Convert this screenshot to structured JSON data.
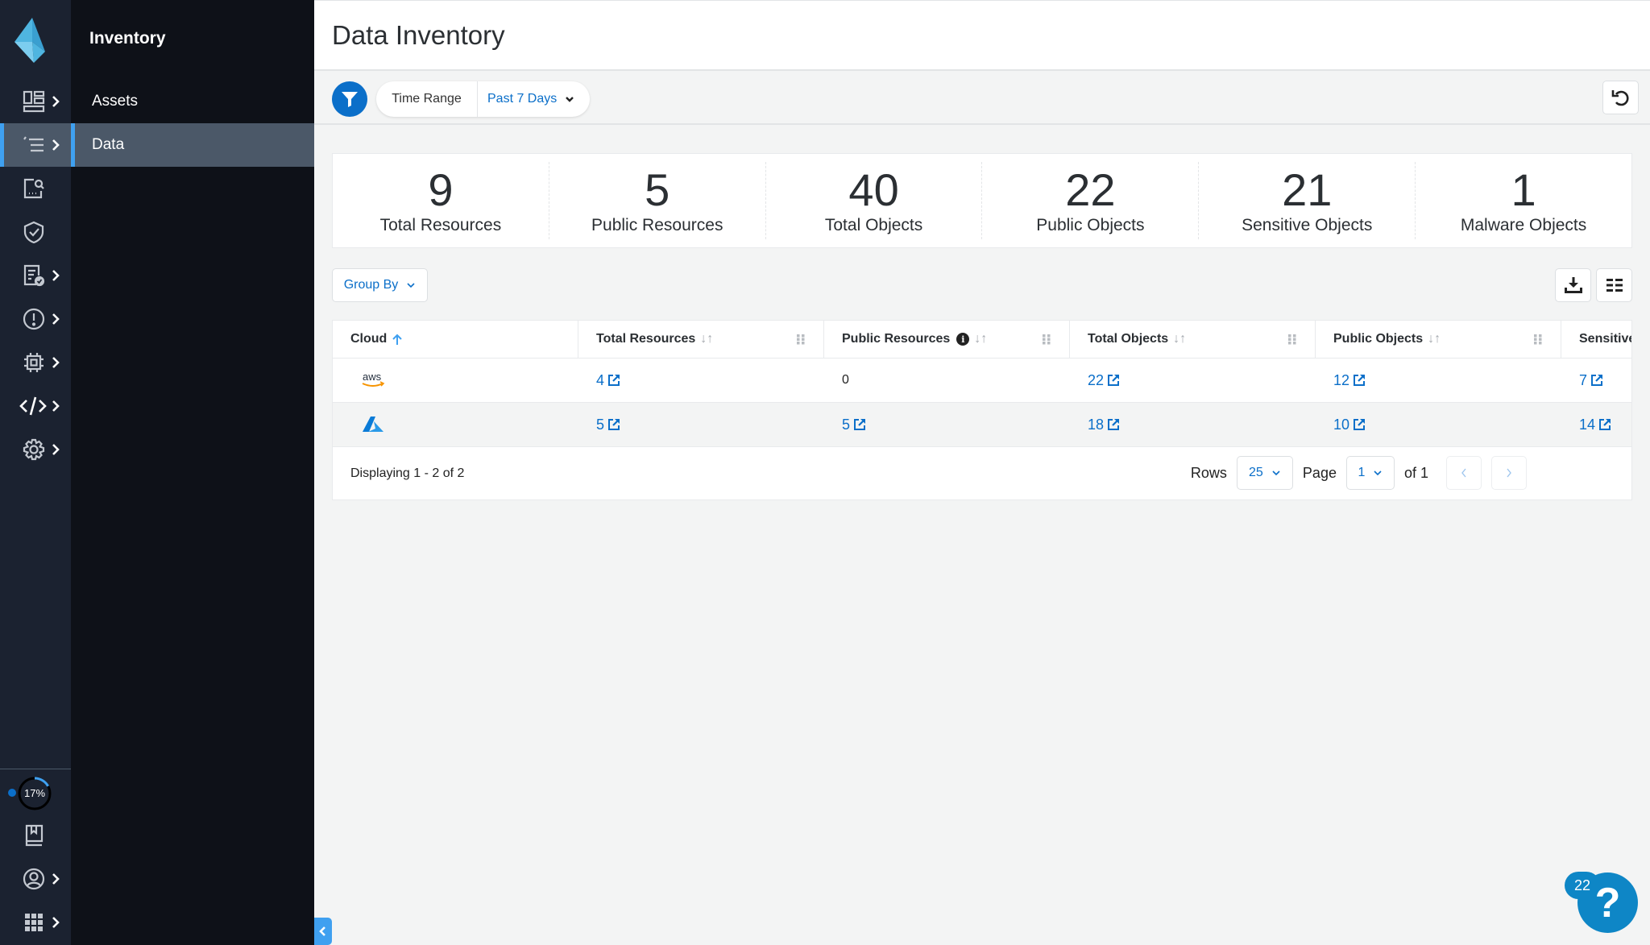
{
  "app": {
    "section_title": "Inventory",
    "page_title": "Data Inventory"
  },
  "rail": {
    "progress_label": "17%",
    "progress_fraction": 0.17
  },
  "subnav": {
    "items": [
      {
        "label": "Assets",
        "active": false
      },
      {
        "label": "Data",
        "active": true
      }
    ]
  },
  "filter": {
    "label": "Time Range",
    "value": "Past 7 Days"
  },
  "stats": [
    {
      "value": "9",
      "label": "Total Resources"
    },
    {
      "value": "5",
      "label": "Public Resources"
    },
    {
      "value": "40",
      "label": "Total Objects"
    },
    {
      "value": "22",
      "label": "Public Objects"
    },
    {
      "value": "21",
      "label": "Sensitive Objects"
    },
    {
      "value": "1",
      "label": "Malware Objects"
    }
  ],
  "toolbar": {
    "group_by_label": "Group By"
  },
  "table": {
    "columns": [
      "Cloud",
      "Total Resources",
      "Public Resources",
      "Total Objects",
      "Public Objects",
      "Sensitive"
    ],
    "rows": [
      {
        "cloud": "aws",
        "total_resources": "4",
        "public_resources": "0",
        "total_objects": "22",
        "public_objects": "12",
        "sensitive": "7"
      },
      {
        "cloud": "azure",
        "total_resources": "5",
        "public_resources": "5",
        "total_objects": "18",
        "public_objects": "10",
        "sensitive": "14"
      }
    ]
  },
  "footer": {
    "displaying": "Displaying 1 - 2 of 2",
    "rows_label": "Rows",
    "rows_value": "25",
    "page_label": "Page",
    "page_value": "1",
    "of_label": "of 1"
  },
  "help": {
    "badge_count": "22",
    "glyph": "?"
  },
  "colors": {
    "accent": "#0b6fc9",
    "active_bar": "#3fa0f0",
    "rail_bg": "#1b2230",
    "subnav_bg": "#0e1118",
    "help_bg": "#0e86c6"
  }
}
